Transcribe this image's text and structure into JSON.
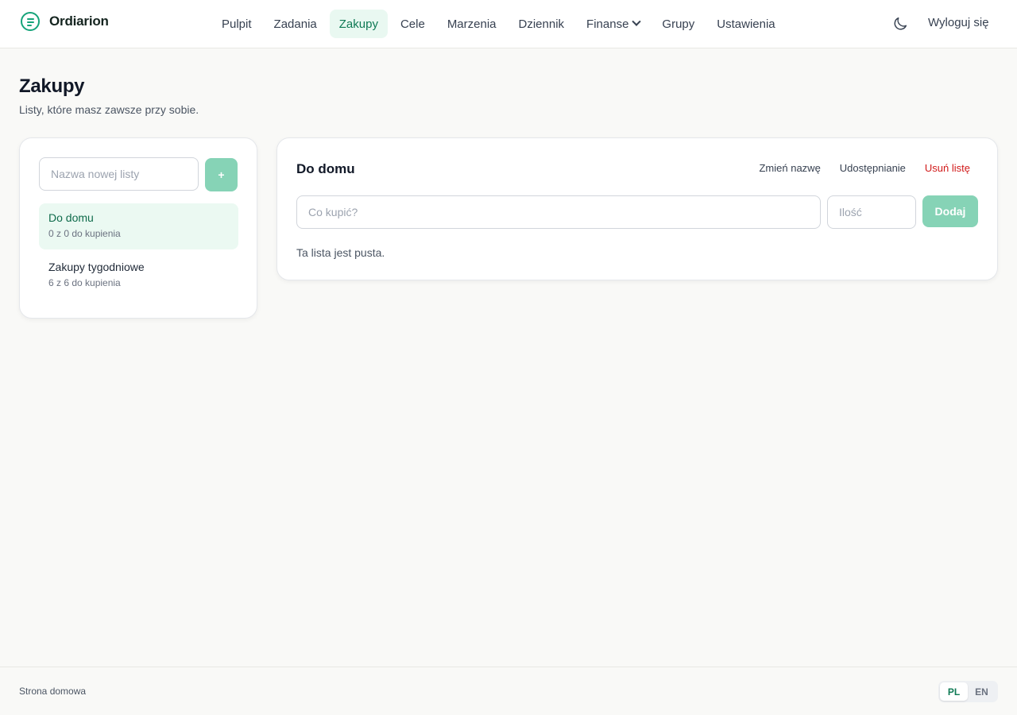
{
  "app": {
    "name": "Ordiarion"
  },
  "nav": {
    "items": [
      {
        "label": "Pulpit"
      },
      {
        "label": "Zadania"
      },
      {
        "label": "Zakupy"
      },
      {
        "label": "Cele"
      },
      {
        "label": "Marzenia"
      },
      {
        "label": "Dziennik"
      },
      {
        "label": "Finanse"
      },
      {
        "label": "Grupy"
      },
      {
        "label": "Ustawienia"
      }
    ],
    "active": "Zakupy",
    "logout_label": "Wyloguj się",
    "theme_icon": "moon-icon"
  },
  "page": {
    "title": "Zakupy",
    "subtitle": "Listy, które masz zawsze przy sobie."
  },
  "sidebar": {
    "new_list_placeholder": "Nazwa nowej listy",
    "add_button_label": "+",
    "lists": [
      {
        "name": "Do domu",
        "count_text": "0 z 0 do kupienia"
      },
      {
        "name": "Zakupy tygodniowe",
        "count_text": "6 z 6 do kupienia"
      }
    ]
  },
  "main": {
    "title": "Do domu",
    "actions": {
      "rename": "Zmień nazwę",
      "share": "Udostępnianie",
      "delete": "Usuń listę"
    },
    "item_placeholder": "Co kupić?",
    "quantity_placeholder": "Ilość",
    "add_button_label": "Dodaj",
    "empty_message": "Ta lista jest pusta."
  },
  "footer": {
    "home_link": "Strona domowa",
    "languages": [
      "PL",
      "EN"
    ],
    "active_language": "PL"
  },
  "colors": {
    "accent": "#16a37a",
    "accent_light": "#e9f8f1",
    "button_disabled": "#86d3b6",
    "danger": "#d11a1a"
  }
}
